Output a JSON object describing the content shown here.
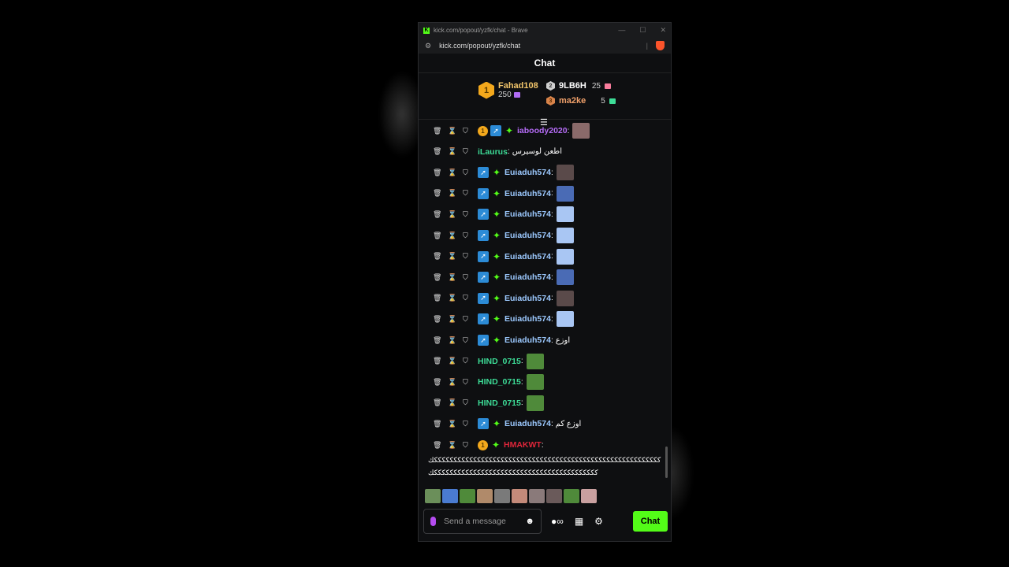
{
  "window": {
    "title": "kick.com/popout/yzfk/chat - Brave",
    "url": "kick.com/popout/yzfk/chat"
  },
  "header": {
    "title": "Chat"
  },
  "leaderboard": [
    {
      "rank": "1",
      "name": "Fahad108",
      "count": "250",
      "color": "#f3c66b",
      "gift_color": "#b16df5"
    },
    {
      "rank": "2",
      "name": "9LB6H",
      "count": "25",
      "color": "#ffffff",
      "gift_color": "#f87c9c"
    },
    {
      "rank": "3",
      "name": "ma2ke",
      "count": "5",
      "color": "#f0a06a",
      "gift_color": "#3ddc97"
    }
  ],
  "messages": [
    {
      "user": "iaboody2020",
      "color": "#b56cf7",
      "text": "",
      "emote": "#8a6a6a"
    },
    {
      "user": "iLaurus",
      "color": "#3ddc97",
      "text": "اطعن لوسيرس",
      "emote": ""
    },
    {
      "user": "Euiaduh574",
      "color": "#9cc9ff",
      "text": "",
      "emote": "#5a4a4a"
    },
    {
      "user": "Euiaduh574",
      "color": "#9cc9ff",
      "text": "",
      "emote": "#4a6bb5"
    },
    {
      "user": "Euiaduh574",
      "color": "#9cc9ff",
      "text": "",
      "emote": "#a9c6f3"
    },
    {
      "user": "Euiaduh574",
      "color": "#9cc9ff",
      "text": "",
      "emote": "#a9c6f3"
    },
    {
      "user": "Euiaduh574",
      "color": "#9cc9ff",
      "text": "",
      "emote": "#a9c6f3"
    },
    {
      "user": "Euiaduh574",
      "color": "#9cc9ff",
      "text": "",
      "emote": "#4a6bb5"
    },
    {
      "user": "Euiaduh574",
      "color": "#9cc9ff",
      "text": "",
      "emote": "#5a4a4a"
    },
    {
      "user": "Euiaduh574",
      "color": "#9cc9ff",
      "text": "",
      "emote": "#a9c6f3"
    },
    {
      "user": "Euiaduh574",
      "color": "#9cc9ff",
      "text": "اوزع",
      "emote": ""
    },
    {
      "user": "HIND_0715",
      "color": "#3ddc97",
      "text": "",
      "emote": "#4f8a3a"
    },
    {
      "user": "HIND_0715",
      "color": "#3ddc97",
      "text": "",
      "emote": "#4f8a3a"
    },
    {
      "user": "HIND_0715",
      "color": "#3ddc97",
      "text": "",
      "emote": "#4f8a3a"
    },
    {
      "user": "Euiaduh574",
      "color": "#9cc9ff",
      "text": "اوزع كم",
      "emote": ""
    },
    {
      "user": "HMAKWT",
      "color": "#e0263a",
      "text": "",
      "emote": ""
    }
  ],
  "long_message": {
    "line1": "ككككككككككككككككككككككككككككككككككككككككككككككككككككككككككك",
    "line2": "ككككككككككككككككككككككككككككككككككككككككككك"
  },
  "input": {
    "placeholder": "Send a message"
  },
  "chat_button": "Chat",
  "emote_bar": [
    "#6b8f5a",
    "#4a7bd1",
    "#4f8a3a",
    "#b08a6a",
    "#7a7a7a",
    "#c48a7a",
    "#8a7a7a",
    "#6a5a5a",
    "#4f8a3a",
    "#c9a0a0"
  ]
}
